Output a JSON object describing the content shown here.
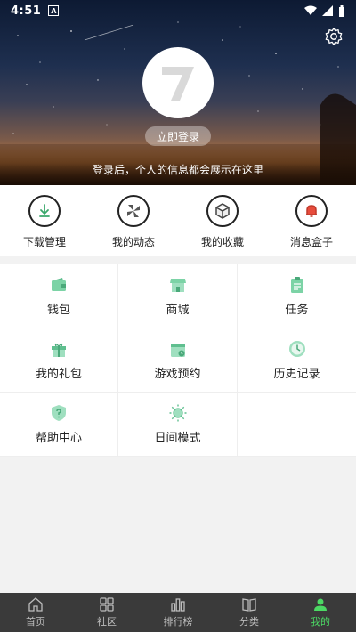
{
  "status": {
    "time": "4:51",
    "notif_glyph": "A"
  },
  "profile": {
    "login_label": "立即登录",
    "hint": "登录后，个人的信息都会展示在这里"
  },
  "quick_actions": [
    {
      "label": "下载管理",
      "icon": "download-icon"
    },
    {
      "label": "我的动态",
      "icon": "pinwheel-icon"
    },
    {
      "label": "我的收藏",
      "icon": "box-icon"
    },
    {
      "label": "消息盒子",
      "icon": "bell-icon"
    }
  ],
  "menu": [
    {
      "label": "钱包",
      "icon": "wallet-icon"
    },
    {
      "label": "商城",
      "icon": "store-icon"
    },
    {
      "label": "任务",
      "icon": "clipboard-icon"
    },
    {
      "label": "我的礼包",
      "icon": "gift-icon"
    },
    {
      "label": "游戏预约",
      "icon": "calendar-icon"
    },
    {
      "label": "历史记录",
      "icon": "clock-icon"
    },
    {
      "label": "帮助中心",
      "icon": "help-shield-icon"
    },
    {
      "label": "日间模式",
      "icon": "sun-icon"
    }
  ],
  "bottom_nav": [
    {
      "label": "首页",
      "icon": "home-icon"
    },
    {
      "label": "社区",
      "icon": "grid-icon"
    },
    {
      "label": "排行榜",
      "icon": "ranking-icon"
    },
    {
      "label": "分类",
      "icon": "book-icon"
    },
    {
      "label": "我的",
      "icon": "person-icon",
      "active": true
    }
  ],
  "colors": {
    "accent": "#4cd964",
    "icon_green": "#5fbf8f",
    "nav_bg": "#3a3a3a"
  }
}
